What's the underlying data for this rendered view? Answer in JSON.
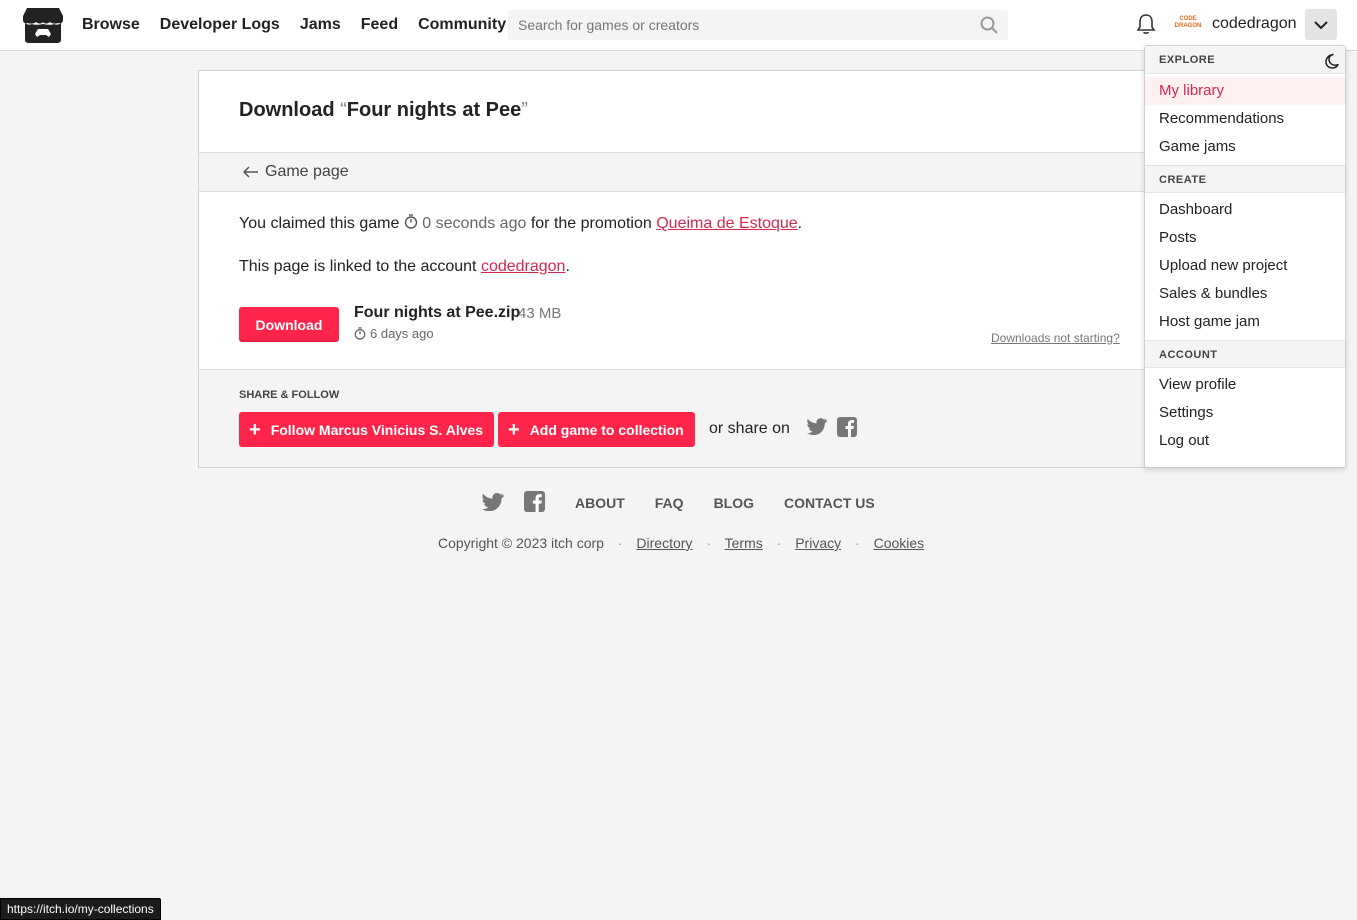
{
  "header": {
    "nav": [
      "Browse",
      "Developer Logs",
      "Jams",
      "Feed",
      "Community"
    ],
    "search_placeholder": "Search for games or creators",
    "avatar_text": "CODE DRAGON",
    "username": "codedragon"
  },
  "card": {
    "title_prefix": "Download ",
    "open_quote": "“",
    "game_title": "Four nights at Pee",
    "close_quote": "”",
    "back_label": "Game page",
    "claimed_prefix": "You claimed this game",
    "claimed_time": "0 seconds ago",
    "claimed_middle": "for the promotion",
    "promotion": "Queima de Estoque",
    "claimed_suffix": ".",
    "linked_prefix": "This page is linked to the account",
    "linked_account": "codedragon",
    "linked_suffix": ".",
    "download_label": "Download",
    "file_name": "Four nights at Pee.zip",
    "file_size": "43 MB",
    "file_date": "6 days ago",
    "not_starting": "Downloads not starting?",
    "share_label": "SHARE & FOLLOW",
    "follow_label": "Follow Marcus Vinicius S. Alves",
    "collection_label": "Add game to collection",
    "share_on": "or share on"
  },
  "footer": {
    "links": [
      "ABOUT",
      "FAQ",
      "BLOG",
      "CONTACT US"
    ],
    "copyright": "Copyright © 2023 itch corp",
    "legal": [
      "Directory",
      "Terms",
      "Privacy",
      "Cookies"
    ],
    "separator": "·"
  },
  "menu": {
    "explore_header": "EXPLORE",
    "explore": [
      "My library",
      "Recommendations",
      "Game jams"
    ],
    "create_header": "CREATE",
    "create": [
      "Dashboard",
      "Posts",
      "Upload new project",
      "Sales & bundles",
      "Host game jam"
    ],
    "account_header": "ACCOUNT",
    "account": [
      "View profile",
      "Settings",
      "Log out"
    ]
  },
  "statusbar": {
    "url": "https://itch.io/my-collections"
  },
  "colors": {
    "accent": "#ff2449",
    "link": "#d6294e",
    "background": "#f4f4f4"
  },
  "icons": [
    "itch-logo-icon",
    "search-icon",
    "bell-icon",
    "chevron-down-icon",
    "arrow-left-icon",
    "timer-icon",
    "plus-icon",
    "twitter-icon",
    "facebook-icon",
    "moon-icon"
  ]
}
